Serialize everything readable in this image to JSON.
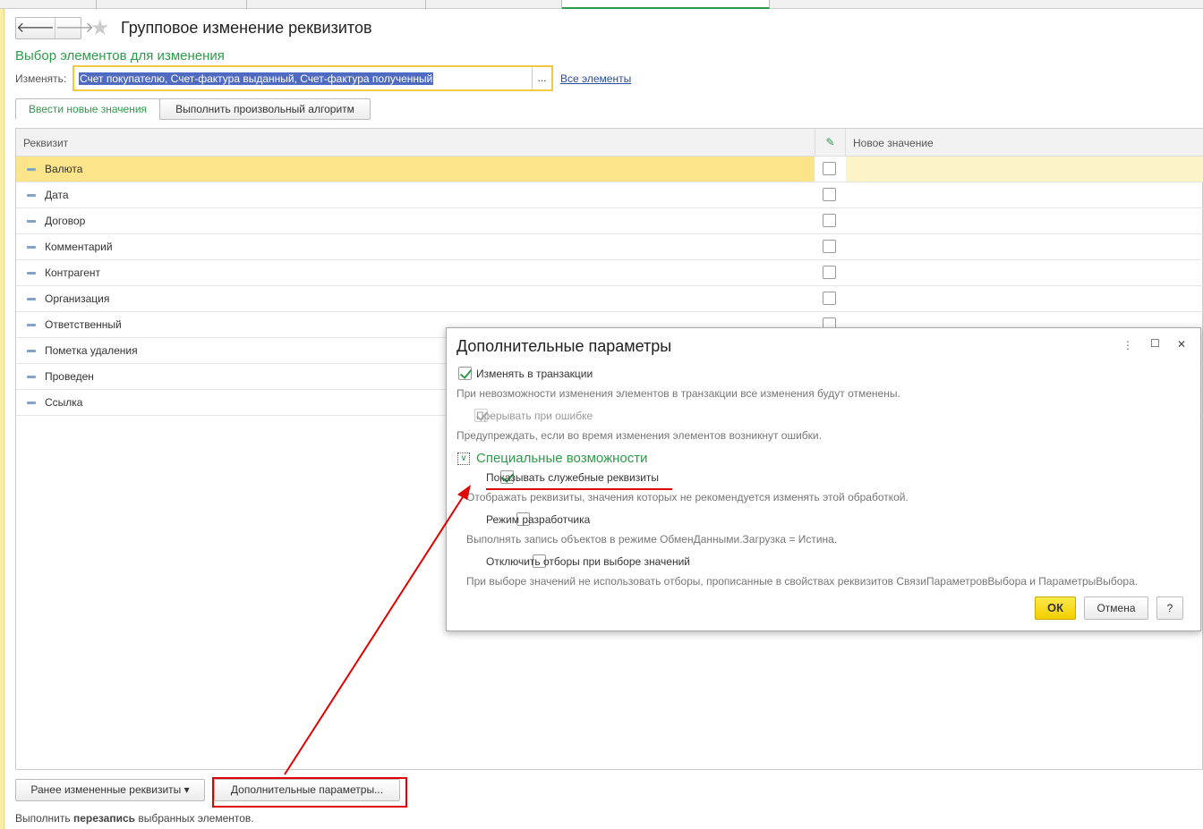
{
  "header": {
    "title": "Групповое изменение реквизитов",
    "back_icon": "arrow-left",
    "forward_icon": "arrow-right",
    "favorite_icon": "star"
  },
  "selection": {
    "section_title": "Выбор элементов для изменения",
    "label": "Изменять:",
    "value": "Счет покупателю, Счет-фактура выданный, Счет-фактура полученный",
    "select_button": "...",
    "all_link": "Все элементы"
  },
  "mode_tabs": [
    "Ввести новые значения",
    "Выполнить произвольный алгоритм"
  ],
  "table": {
    "columns": [
      "Реквизит",
      "Новое значение"
    ],
    "rows": [
      "Валюта",
      "Дата",
      "Договор",
      "Комментарий",
      "Контрагент",
      "Организация",
      "Ответственный",
      "Пометка удаления",
      "Проведен",
      "Ссылка"
    ]
  },
  "footer": {
    "prev_button": "Ранее измененные реквизиты",
    "extra_button": "Дополнительные параметры...",
    "status_prefix": "Выполнить ",
    "status_bold": "перезапись",
    "status_suffix": " выбранных элементов."
  },
  "dialog": {
    "title": "Дополнительные параметры",
    "opt1": {
      "label": "Изменять в транзакции",
      "checked": true,
      "hint": "При невозможности изменения элементов в транзакции все изменения будут отменены."
    },
    "opt2": {
      "label": "Прерывать при ошибке",
      "checked": true,
      "disabled": true,
      "hint": "Предупреждать, если во время изменения элементов возникнут ошибки."
    },
    "group": "Специальные возможности",
    "opt3": {
      "label": "Показывать служебные реквизиты",
      "checked": true,
      "hint": "Отображать реквизиты, значения которых не рекомендуется изменять этой обработкой."
    },
    "opt4": {
      "label": "Режим разработчика",
      "checked": false,
      "hint": "Выполнять запись объектов в режиме ОбменДанными.Загрузка = Истина."
    },
    "opt5": {
      "label": "Отключить отборы при выборе значений",
      "checked": false,
      "hint": "При выборе значений не использовать отборы, прописанные в свойствах реквизитов СвязиПараметровВыбора и ПараметрыВыбора."
    },
    "ok": "ОК",
    "cancel": "Отмена",
    "help": "?",
    "more": "⋮",
    "maximize": "☐",
    "close": "✕"
  },
  "colors": {
    "accent": "#2e9b4a",
    "selected_row": "#fbe48a",
    "annotation": "#e00000"
  }
}
